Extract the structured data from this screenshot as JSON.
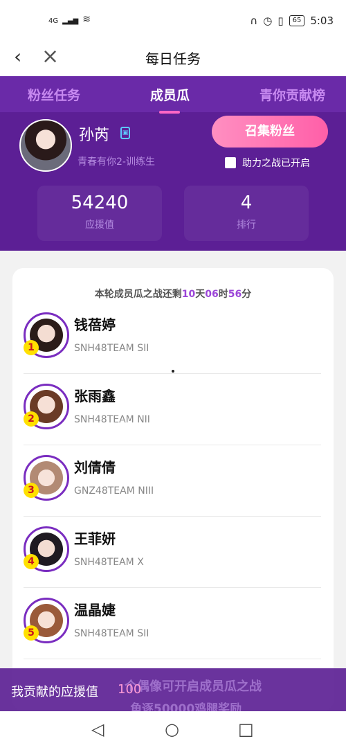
{
  "status_bar": {
    "signal": "4G",
    "battery": "65",
    "time": "5:03"
  },
  "header": {
    "title": "每日任务"
  },
  "tabs": [
    {
      "label": "粉丝任务",
      "active": false
    },
    {
      "label": "成员瓜",
      "active": true
    },
    {
      "label": "青你贡献榜",
      "active": false
    }
  ],
  "profile": {
    "name": "孙芮",
    "subtitle": "青春有你2-训练生",
    "recruit_button": "召集粉丝",
    "battle_label": "助力之战已开启",
    "stats": [
      {
        "value": "54240",
        "label": "应援值"
      },
      {
        "value": "4",
        "label": "排行"
      }
    ]
  },
  "countdown": {
    "prefix": "本轮成员瓜之战还剩",
    "days": "10",
    "day_unit": "天",
    "hours": "06",
    "hour_unit": "时",
    "minutes": "56",
    "minute_unit": "分"
  },
  "members": [
    {
      "rank": "1",
      "name": "钱蓓婷",
      "team": "SNH48TEAM SII"
    },
    {
      "rank": "2",
      "name": "张雨鑫",
      "team": "SNH48TEAM NII"
    },
    {
      "rank": "3",
      "name": "刘倩倩",
      "team": "GNZ48TEAM NIII"
    },
    {
      "rank": "4",
      "name": "王菲妍",
      "team": "SNH48TEAM X"
    },
    {
      "rank": "5",
      "name": "温晶婕",
      "team": "SNH48TEAM SII"
    }
  ],
  "contribution": {
    "label": "我贡献的应援值",
    "value": "100",
    "behind_line1": "个偶像可开启成员瓜之战",
    "behind_line2": "角逐50000鸡腿奖励"
  },
  "colors": {
    "accent": "#5c1f95",
    "tab_active_indicator": "#ff66c4",
    "rank_badge": "#ffe000"
  }
}
